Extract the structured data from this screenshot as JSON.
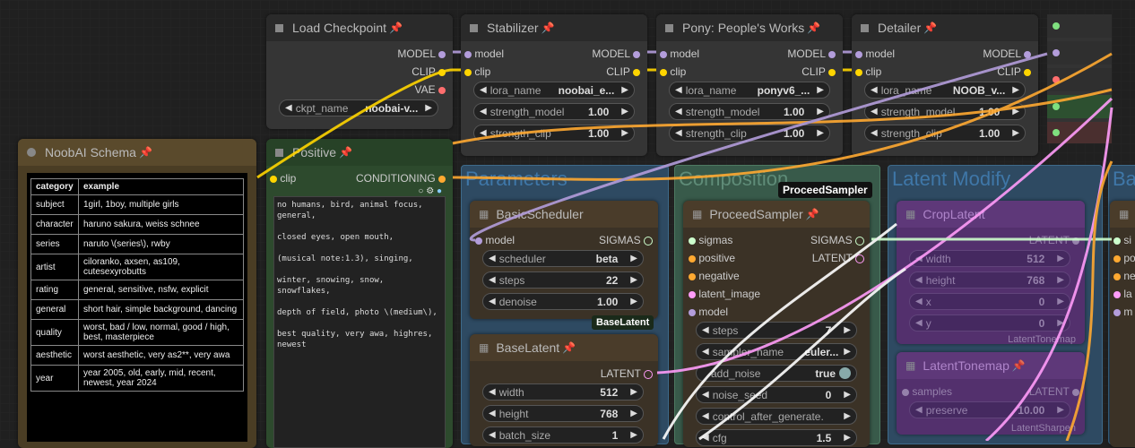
{
  "colors": {
    "model": "#b39ddb",
    "clip": "#ffd500",
    "vae": "#ff6e6e",
    "conditioning": "#ffa931",
    "latent": "#ff9cf9",
    "sigmas": "#cdffcd",
    "background": "#202020"
  },
  "groups": {
    "parameters": "Parameters",
    "composition": "Composition",
    "latent_modify": "Latent Modify"
  },
  "tooltip": "ProceedSampler",
  "load_checkpoint": {
    "title": "Load Checkpoint",
    "outputs": [
      "MODEL",
      "CLIP",
      "VAE"
    ],
    "ckpt_label": "ckpt_name",
    "ckpt_value": "noobai-v..."
  },
  "stabilizer": {
    "title": "Stabilizer",
    "in_model": "model",
    "in_clip": "clip",
    "out_model": "MODEL",
    "out_clip": "CLIP",
    "lora_label": "lora_name",
    "lora_value": "noobai_e...",
    "sm_label": "strength_model",
    "sm_value": "1.00",
    "sc_label": "strength_clip",
    "sc_value": "1.00"
  },
  "pony": {
    "title": "Pony: People's Works",
    "in_model": "model",
    "in_clip": "clip",
    "out_model": "MODEL",
    "out_clip": "CLIP",
    "lora_label": "lora_name",
    "lora_value": "ponyv6_...",
    "sm_label": "strength_model",
    "sm_value": "1.00",
    "sc_label": "strength_clip",
    "sc_value": "1.00"
  },
  "detailer": {
    "title": "Detailer",
    "in_model": "model",
    "in_clip": "clip",
    "out_model": "MODEL",
    "out_clip": "CLIP",
    "lora_label": "lora_name",
    "lora_value": "NOOB_v...",
    "sm_label": "strength_model",
    "sm_value": "1.00",
    "sc_label": "strength_clip",
    "sc_value": "1.00"
  },
  "schema": {
    "title": "NoobAI Schema",
    "headers": [
      "category",
      "example"
    ],
    "rows": [
      [
        "subject",
        "1girl, 1boy, multiple girls"
      ],
      [
        "character",
        "haruno sakura, weiss schnee"
      ],
      [
        "series",
        "naruto \\(series\\), rwby"
      ],
      [
        "artist",
        "ciloranko, axsen, as109, cutesexyrobutts"
      ],
      [
        "rating",
        "general, sensitive, nsfw, explicit"
      ],
      [
        "general",
        "short hair, simple background, dancing"
      ],
      [
        "quality",
        "worst, bad / low, normal, good / high, best, masterpiece"
      ],
      [
        "aesthetic",
        "worst aesthetic, very as2**, very awa"
      ],
      [
        "year",
        "year 2005, old, early, mid, recent, newest, year 2024"
      ]
    ]
  },
  "positive": {
    "title": "Positive",
    "in_clip": "clip",
    "out_cond": "CONDITIONING",
    "text": "no humans, bird, animal focus, general,\n\nclosed eyes, open mouth,\n\n(musical note:1.3), singing,\n\nwinter, snowing, snow, snowflakes,\n\ndepth of field, photo \\(medium\\),\n\nbest quality, very awa, highres, newest"
  },
  "basic_scheduler": {
    "title": "BasicScheduler",
    "in_model": "model",
    "out_sigmas": "SIGMAS",
    "scheduler_label": "scheduler",
    "scheduler_value": "beta",
    "steps_label": "steps",
    "steps_value": "22",
    "denoise_label": "denoise",
    "denoise_value": "1.00"
  },
  "base_latent_badge": "BaseLatent",
  "base_latent": {
    "title": "BaseLatent",
    "out_latent": "LATENT",
    "width_label": "width",
    "width_value": "512",
    "height_label": "height",
    "height_value": "768",
    "batch_label": "batch_size",
    "batch_value": "1"
  },
  "proceed_sampler": {
    "title": "ProceedSampler",
    "inputs": [
      "sigmas",
      "positive",
      "negative",
      "latent_image",
      "model"
    ],
    "out_sigmas": "SIGMAS",
    "out_latent": "LATENT",
    "steps_label": "steps",
    "steps_value": "7",
    "sampler_label": "sampler_name",
    "sampler_value": "euler...",
    "noise_label": "add_noise",
    "noise_value": "true",
    "seed_label": "noise_seed",
    "seed_value": "0",
    "control_label": "control_after_generate.",
    "cfg_label": "cfg",
    "cfg_value": "1.5"
  },
  "crop_latent": {
    "title": "CropLatent",
    "out_latent": "LATENT",
    "width_label": "width",
    "width_value": "512",
    "height_label": "height",
    "height_value": "768",
    "x_label": "x",
    "x_value": "0",
    "y_label": "y",
    "y_value": "0",
    "footer": "LatentTonemap"
  },
  "latent_tonemap": {
    "title": "LatentTonemap",
    "in_samples": "samples",
    "out_latent": "LATENT",
    "preserve_label": "preserve",
    "preserve_value": "10.00",
    "footer": "LatentSharpen"
  },
  "right_partial": {
    "group_title": "Bas",
    "inputs": [
      "si",
      "po",
      "ne",
      "la",
      "m"
    ]
  }
}
